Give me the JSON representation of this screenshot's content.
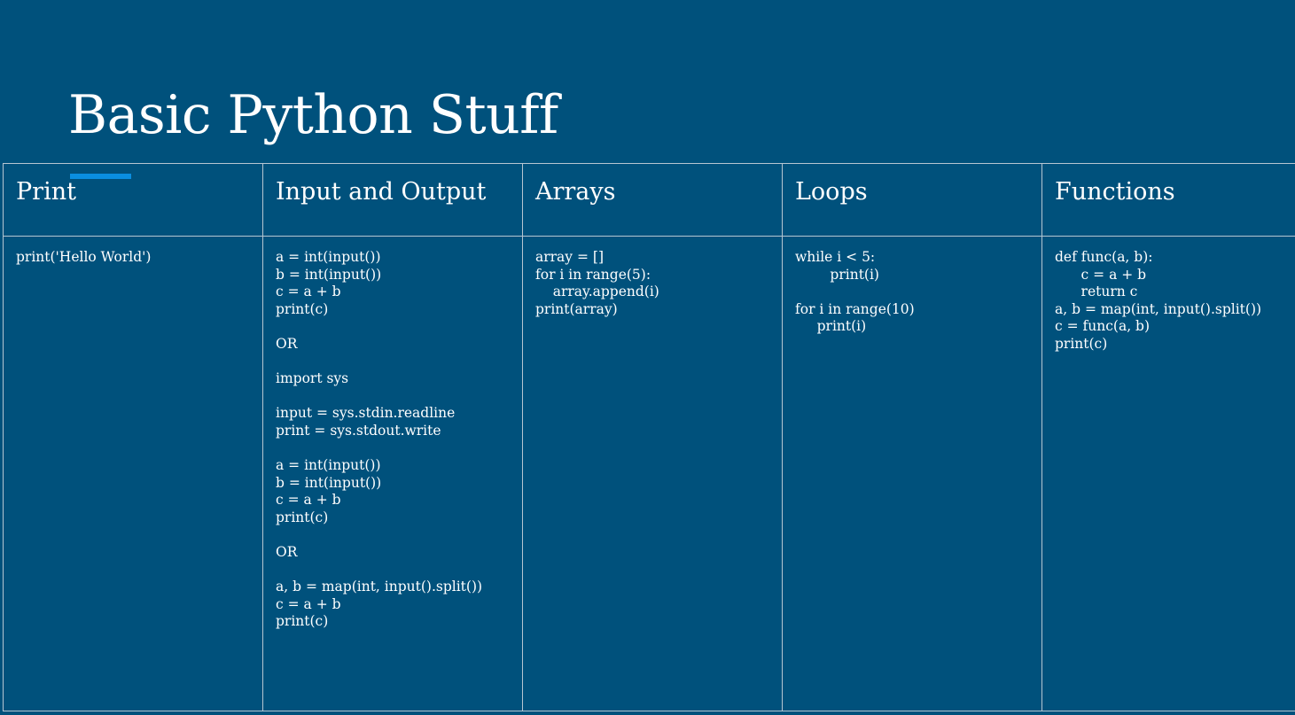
{
  "slide": {
    "title": "Basic Python Stuff"
  },
  "table": {
    "columns": [
      {
        "header": "Print",
        "body": "print('Hello World')"
      },
      {
        "header": "Input and Output",
        "body": "a = int(input())\nb = int(input())\nc = a + b\nprint(c)\n\nOR\n\nimport sys\n\ninput = sys.stdin.readline\nprint = sys.stdout.write\n\na = int(input())\nb = int(input())\nc = a + b\nprint(c)\n\nOR\n\na, b = map(int, input().split())\nc = a + b\nprint(c)"
      },
      {
        "header": "Arrays",
        "body": "array = []\nfor i in range(5):\n    array.append(i)\nprint(array)"
      },
      {
        "header": "Loops",
        "body": "while i < 5:\n        print(i)\n\nfor i in range(10)\n     print(i)"
      },
      {
        "header": "Functions",
        "body": "def func(a, b):\n      c = a + b\n      return c\na, b = map(int, input().split())\nc = func(a, b)\nprint(c)"
      }
    ]
  },
  "colors": {
    "background": "#00517c",
    "accent": "#0a8ee0",
    "grid_line": "#b7c6d1",
    "text": "#ffffff"
  }
}
